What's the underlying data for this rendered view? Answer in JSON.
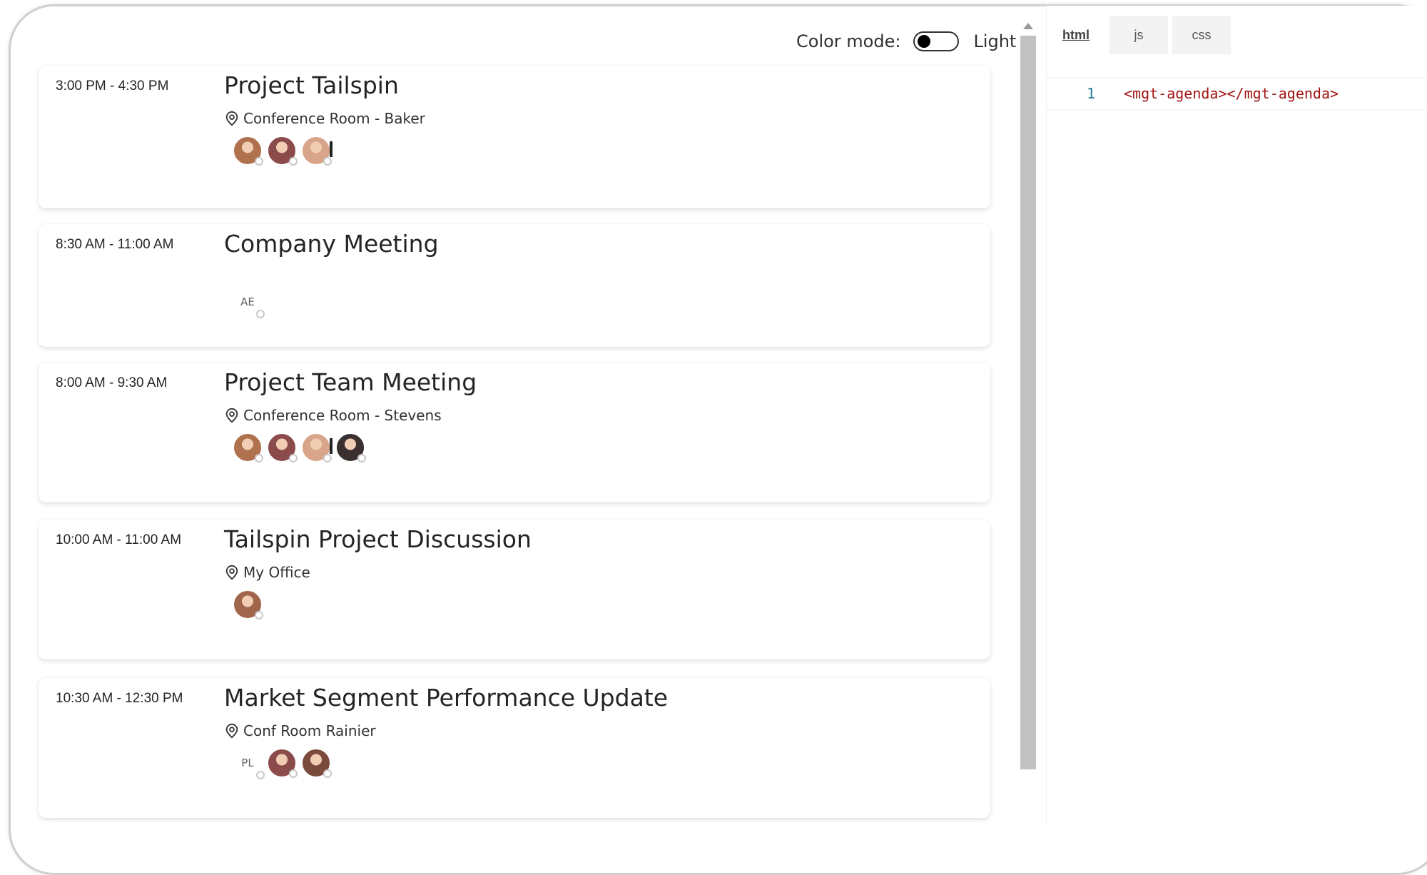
{
  "header": {
    "color_mode_label": "Color mode:",
    "theme_value": "Light"
  },
  "agenda": {
    "events": [
      {
        "time": "3:00 PM - 4:30 PM",
        "title": "Project Tailspin",
        "location": "Conference Room - Baker",
        "attendees": [
          {
            "type": "photo",
            "color": "#b0714f"
          },
          {
            "type": "photo",
            "color": "#8c4b4b"
          },
          {
            "type": "photo",
            "color": "#d9a58a",
            "alert": true
          }
        ]
      },
      {
        "time": "8:30 AM - 11:00 AM",
        "title": "Company Meeting",
        "location": "",
        "attendees": [
          {
            "type": "initials",
            "initials": "AE"
          }
        ]
      },
      {
        "time": "8:00 AM - 9:30 AM",
        "title": "Project Team Meeting",
        "location": "Conference Room - Stevens",
        "attendees": [
          {
            "type": "photo",
            "color": "#b0714f"
          },
          {
            "type": "photo",
            "color": "#8c4b4b"
          },
          {
            "type": "photo",
            "color": "#d9a58a",
            "alert": true
          },
          {
            "type": "photo",
            "color": "#3a3030"
          }
        ]
      },
      {
        "time": "10:00 AM - 11:00 AM",
        "title": "Tailspin Project Discussion",
        "location": "My Office",
        "attendees": [
          {
            "type": "photo",
            "color": "#a0654a"
          }
        ]
      },
      {
        "time": "10:30 AM - 12:30 PM",
        "title": "Market Segment Performance Update",
        "location": "Conf Room Rainier",
        "attendees": [
          {
            "type": "initials",
            "initials": "PL"
          },
          {
            "type": "photo",
            "color": "#8c4b4b"
          },
          {
            "type": "photo",
            "color": "#7a4a3a"
          }
        ]
      }
    ]
  },
  "editor": {
    "tabs": [
      {
        "label": "html",
        "active": true
      },
      {
        "label": "js",
        "active": false
      },
      {
        "label": "css",
        "active": false
      }
    ],
    "lines": [
      {
        "number": "1",
        "code": "<mgt-agenda></mgt-agenda>"
      }
    ]
  }
}
